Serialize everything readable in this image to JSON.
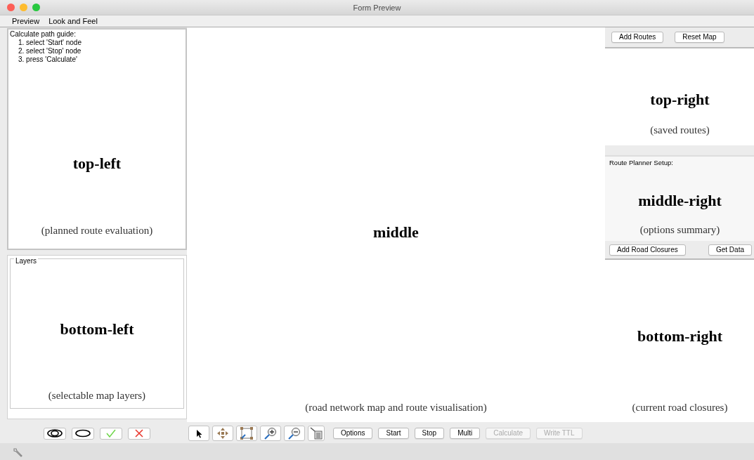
{
  "window": {
    "title": "Form Preview"
  },
  "menu": [
    "Preview",
    "Look and Feel"
  ],
  "top_left": {
    "guide_title": "Calculate path guide:",
    "guide_steps": [
      "1. select 'Start' node",
      "2. select 'Stop' node",
      "3. press 'Calculate'"
    ],
    "heading": "top-left",
    "caption": "(planned route evaluation)"
  },
  "bottom_left": {
    "group_title": "Layers",
    "heading": "bottom-left",
    "caption": "(selectable map layers)"
  },
  "middle": {
    "heading": "middle",
    "caption": "(road network map and route visualisation)"
  },
  "right_top_buttons": [
    {
      "label": "Add Routes",
      "disabled": false
    },
    {
      "label": "Reset Map",
      "disabled": false
    }
  ],
  "top_right": {
    "heading": "top-right",
    "caption": "(saved routes)"
  },
  "middle_right": {
    "title": "Route Planner Setup:",
    "heading": "middle-right",
    "caption": "(options summary)"
  },
  "right_mid_buttons": [
    {
      "label": "Add Road Closures",
      "disabled": false
    },
    {
      "label": "Get Data",
      "disabled": false
    }
  ],
  "bottom_right": {
    "heading": "bottom-right",
    "caption": "(current road closures)"
  },
  "toolbar_buttons": [
    {
      "label": "Options",
      "disabled": false
    },
    {
      "label": "Start",
      "disabled": false
    },
    {
      "label": "Stop",
      "disabled": false
    },
    {
      "label": "Multi",
      "disabled": false
    },
    {
      "label": "Calculate",
      "disabled": true
    },
    {
      "label": "Write TTL",
      "disabled": true
    }
  ]
}
